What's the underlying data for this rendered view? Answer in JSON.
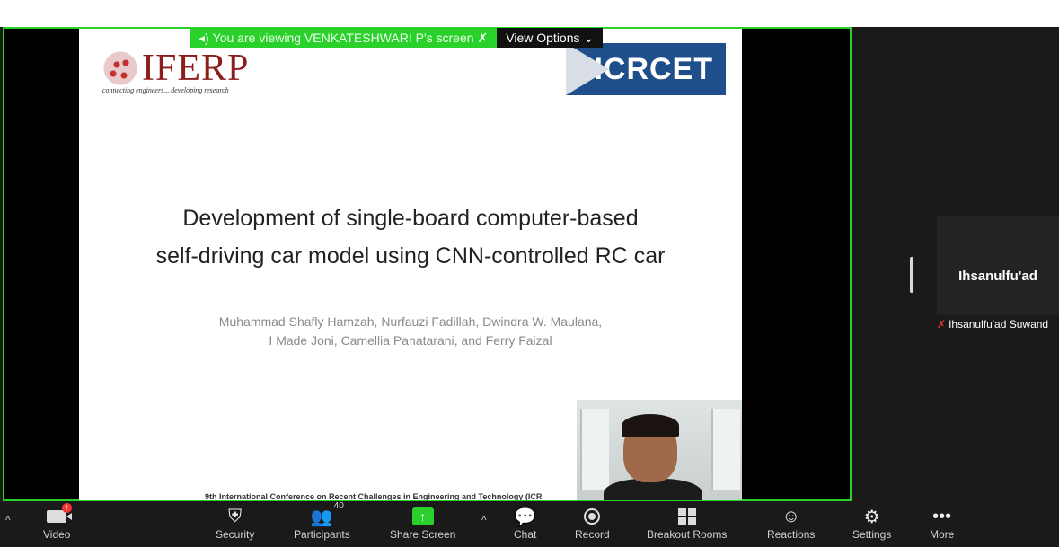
{
  "banner": {
    "viewing_text": "You are viewing VENKATESHWARI P's screen",
    "view_options": "View Options"
  },
  "slide": {
    "logo_left": "IFERP",
    "logo_left_tagline": "connecting engineers... developing research",
    "logo_right": "ICRCET",
    "title_line1": "Development of single-board computer-based",
    "title_line2": "self-driving car model using CNN-controlled RC car",
    "authors_line1": "Muhammad Shafly Hamzah, Nurfauzi Fadillah, Dwindra W. Maulana,",
    "authors_line2": "I Made Joni, Camellia Panatarani, and Ferry Faizal",
    "footer": "9th International Conference on Recent Challenges in Engineering and Technology (ICR"
  },
  "participant_tile": {
    "name": "Ihsanulfu'ad",
    "label": "Ihsanulfu'ad Suwand"
  },
  "toolbar": {
    "video": "Video",
    "security": "Security",
    "participants": "Participants",
    "participants_count": "40",
    "share_screen": "Share Screen",
    "chat": "Chat",
    "record": "Record",
    "breakout_rooms": "Breakout Rooms",
    "reactions": "Reactions",
    "settings": "Settings",
    "more": "More",
    "video_badge": "!"
  },
  "colors": {
    "share_border": "#2bd12b",
    "toolbar_bg": "#1a1a1a",
    "icrcet_blue": "#1f4f8a",
    "iferp_red": "#8c1d1d"
  }
}
